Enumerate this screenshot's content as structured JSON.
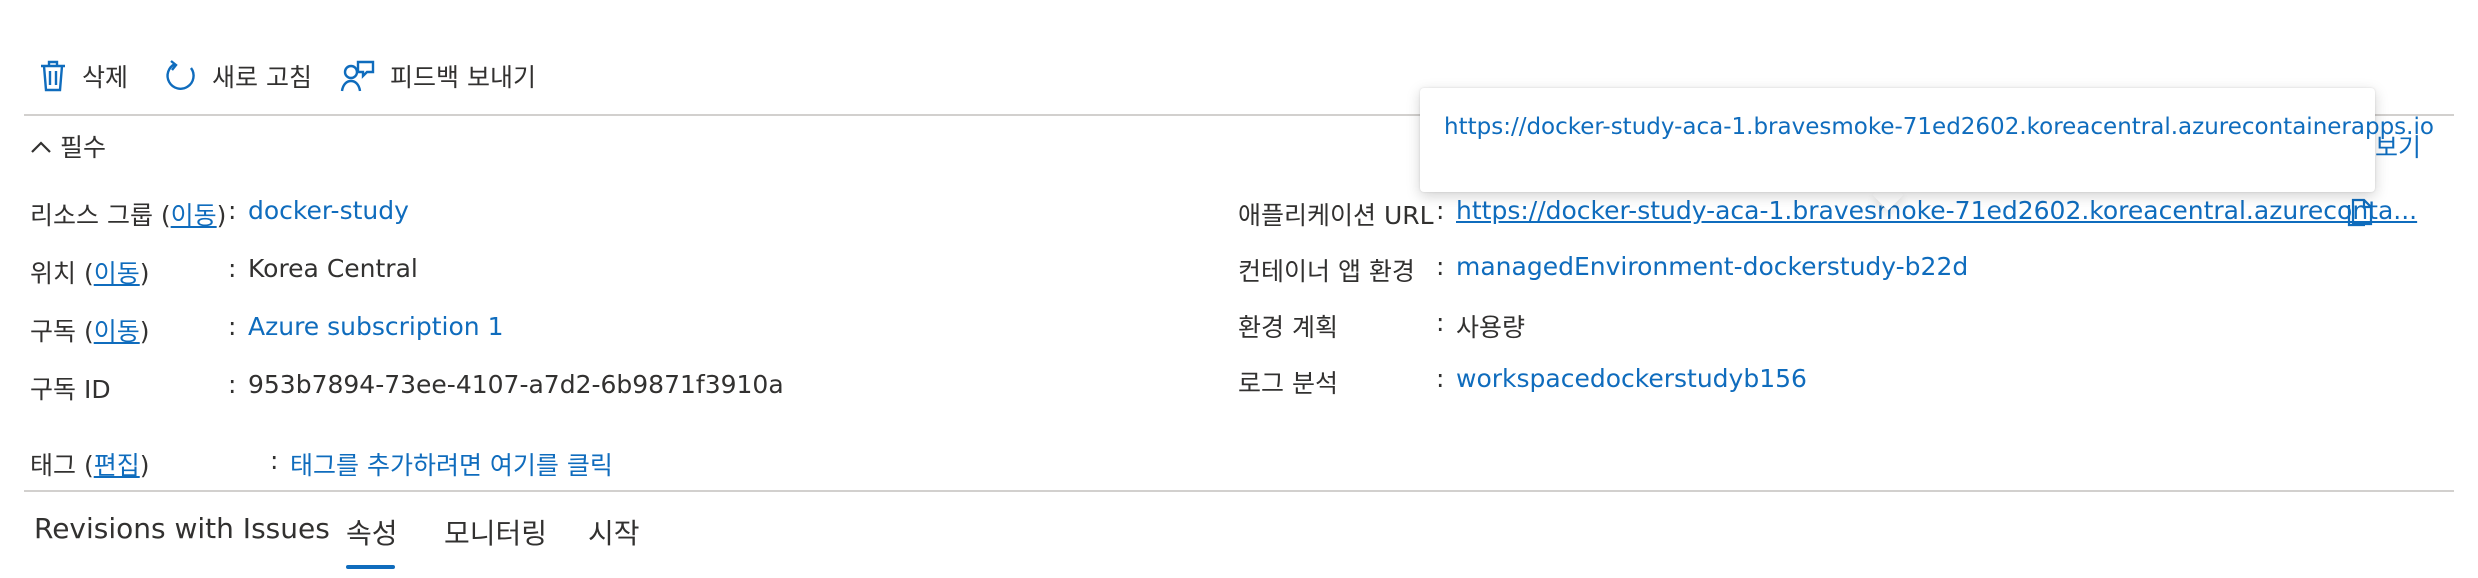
{
  "toolbar": {
    "delete_label": "삭제",
    "refresh_label": "새로 고침",
    "feedback_label": "피드백 보내기"
  },
  "essentials": {
    "section_label": "필수",
    "view_label": "보기",
    "left": {
      "resource_group": {
        "label": "리소스 그룹",
        "action": "이동",
        "value": "docker-study"
      },
      "location": {
        "label": "위치",
        "action": "이동",
        "value": "Korea Central"
      },
      "subscription": {
        "label": "구독",
        "action": "이동",
        "value": "Azure subscription 1"
      },
      "subscription_id": {
        "label": "구독 ID",
        "value": "953b7894-73ee-4107-a7d2-6b9871f3910a"
      }
    },
    "right": {
      "app_url": {
        "label": "애플리케이션 URL",
        "value": "https://docker-study-aca-1.bravesmoke-71ed2602.koreacentral.azureconta..."
      },
      "env": {
        "label": "컨테이너 앱 환경",
        "value": "managedEnvironment-dockerstudy-b22d"
      },
      "plan": {
        "label": "환경 계획",
        "value": "사용량"
      },
      "log": {
        "label": "로그 분석",
        "value": "workspacedockerstudyb156"
      }
    },
    "tags": {
      "label": "태그",
      "action": "편집",
      "value": "태그를 추가하려면 여기를 클릭"
    }
  },
  "tooltip": {
    "text": "https://docker-study-aca-1.bravesmoke-71ed2602.koreacentral.azurecontainerapps.io"
  },
  "tabs": [
    {
      "label": "Revisions with Issues"
    },
    {
      "label": "속성"
    },
    {
      "label": "모니터링"
    },
    {
      "label": "시작"
    }
  ],
  "colors": {
    "link": "#0f6cbd",
    "text": "#323130",
    "divider": "#d2d0ce"
  },
  "icons": [
    "trash-icon",
    "refresh-icon",
    "feedback-icon",
    "chevron-up-icon",
    "copy-icon"
  ]
}
